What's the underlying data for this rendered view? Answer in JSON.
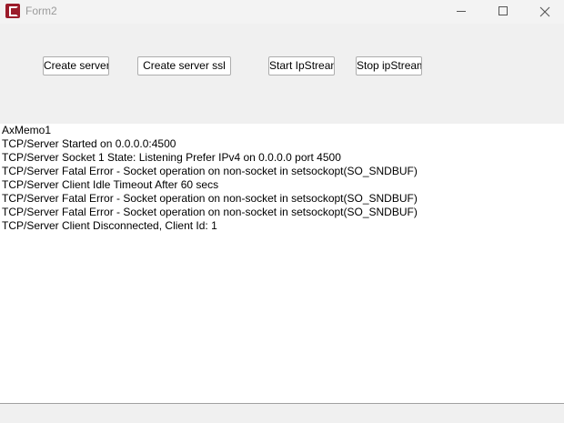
{
  "window": {
    "title": "Form2"
  },
  "buttons": {
    "create_server": "Create server",
    "create_server_ssl": "Create server ssl",
    "start_ipstream": "Start IpStream",
    "stop_ipstream": "Stop ipStream"
  },
  "memo": {
    "lines": [
      "AxMemo1",
      "TCP/Server Started on 0.0.0.0:4500",
      "TCP/Server Socket 1 State: Listening Prefer IPv4 on 0.0.0.0 port 4500",
      "TCP/Server Fatal Error - Socket operation on non-socket in setsockopt(SO_SNDBUF)",
      "TCP/Server Client Idle Timeout After 60 secs",
      "TCP/Server Fatal Error - Socket operation on non-socket in setsockopt(SO_SNDBUF)",
      "TCP/Server Fatal Error - Socket operation on non-socket in setsockopt(SO_SNDBUF)",
      "TCP/Server Client Disconnected, Client Id: 1"
    ]
  },
  "icons": {
    "app": "app-logo-icon",
    "minimize": "minimize-icon",
    "maximize": "maximize-icon",
    "close": "close-icon"
  },
  "colors": {
    "app_icon": "#9b1b2a",
    "window_bg": "#f0f0f0",
    "memo_bg": "#ffffff"
  }
}
